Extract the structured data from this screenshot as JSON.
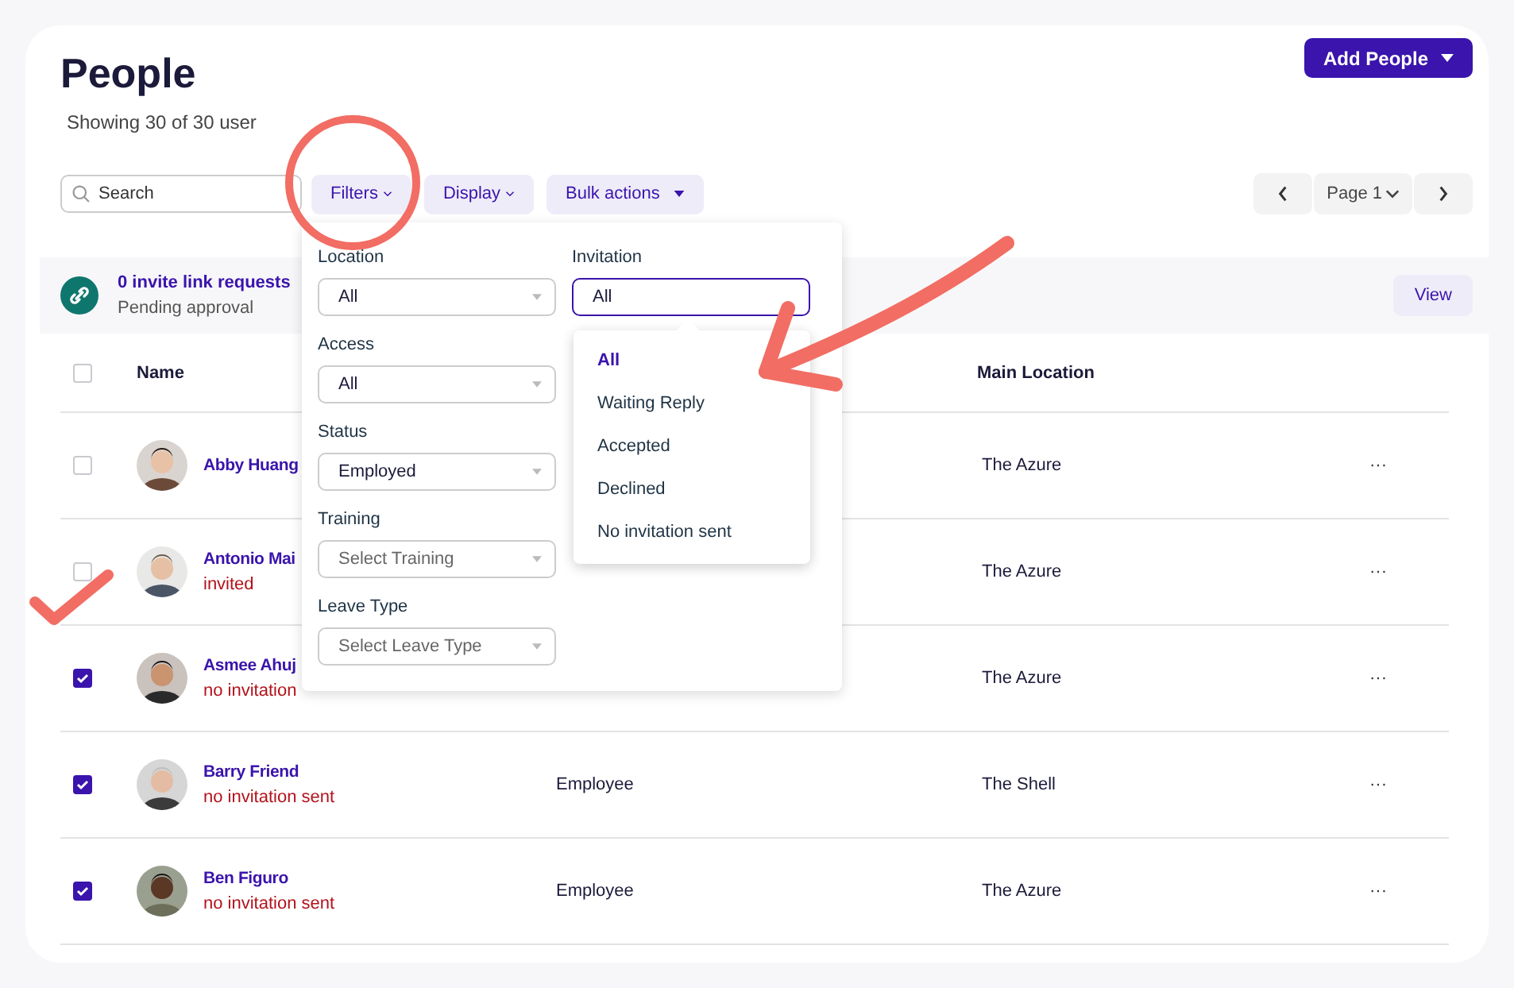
{
  "header": {
    "title": "People",
    "subtitle": "Showing 30 of 30 user",
    "add_button": "Add People"
  },
  "toolbar": {
    "search": {
      "placeholder": "Search"
    },
    "buttons": [
      {
        "label": "Filters",
        "kind": "chevron"
      },
      {
        "label": "Display",
        "kind": "chevron"
      },
      {
        "label": "Bulk actions",
        "kind": "caret"
      }
    ],
    "pagination": {
      "page": "Page 1"
    }
  },
  "invite_banner": {
    "title": "0 invite link requests",
    "subtitle": "Pending approval",
    "button": "View"
  },
  "table": {
    "select_all_checked": false,
    "columns": [
      "Name",
      "Main Location"
    ],
    "rows": [
      {
        "name": "Abby Huang",
        "checked": false,
        "location": "The Azure",
        "menu": "···"
      },
      {
        "name": "Antonio Mai",
        "status": "invited",
        "checked": false,
        "location": "The Azure",
        "menu": "···"
      },
      {
        "name": "Asmee Ahuj",
        "status": "no invitation",
        "checked": true,
        "location": "The Azure",
        "menu": "···"
      },
      {
        "name": "Barry Friend",
        "status": "no invitation sent",
        "checked": true,
        "role": "Employee",
        "location": "The Shell",
        "menu": "···"
      },
      {
        "name": "Ben Figuro",
        "status": "no invitation sent",
        "checked": true,
        "role": "Employee",
        "location": "The Azure",
        "menu": "···"
      }
    ]
  },
  "filter_panel": {
    "fields": [
      {
        "label": "Location",
        "value": "All"
      },
      {
        "label": "Access",
        "value": "All"
      },
      {
        "label": "Status",
        "value": "Employed"
      },
      {
        "label": "Training",
        "placeholder": "Select Training"
      },
      {
        "label": "Leave Type",
        "placeholder": "Select Leave Type"
      }
    ],
    "invitation": {
      "label": "Invitation",
      "value": "All",
      "options": [
        {
          "label": "All",
          "selected": true
        },
        {
          "label": "Waiting Reply",
          "selected": false
        },
        {
          "label": "Accepted",
          "selected": false
        },
        {
          "label": "Declined",
          "selected": false
        },
        {
          "label": "No invitation sent",
          "selected": false
        }
      ]
    }
  }
}
